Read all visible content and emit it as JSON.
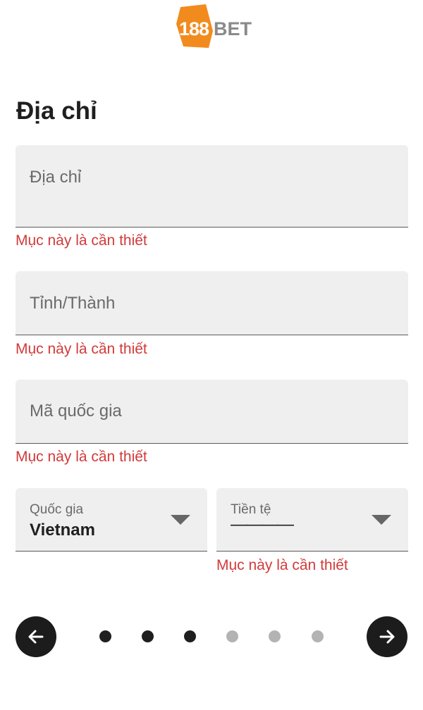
{
  "logo": {
    "text": "188BET",
    "brand_orange": "#f28b1d"
  },
  "page_title": "Địa chỉ",
  "fields": {
    "address": {
      "placeholder": "Địa chỉ",
      "error": "Mục này là cần thiết"
    },
    "city": {
      "placeholder": "Tỉnh/Thành",
      "error": "Mục này là cần thiết"
    },
    "postal": {
      "placeholder": "Mã quốc gia",
      "error": "Mục này là cần thiết"
    }
  },
  "country_select": {
    "label": "Quốc gia",
    "value": "Vietnam"
  },
  "currency_select": {
    "label": "Tiền tệ",
    "value": "————",
    "error": "Mục này là cần thiết"
  },
  "pager": {
    "back_icon": "arrow-left-icon",
    "next_icon": "arrow-right-icon",
    "dots": [
      true,
      true,
      true,
      false,
      false,
      false
    ]
  },
  "colors": {
    "error": "#d23a3a",
    "field_bg": "#efefef",
    "nav_button": "#1c1c1c"
  }
}
